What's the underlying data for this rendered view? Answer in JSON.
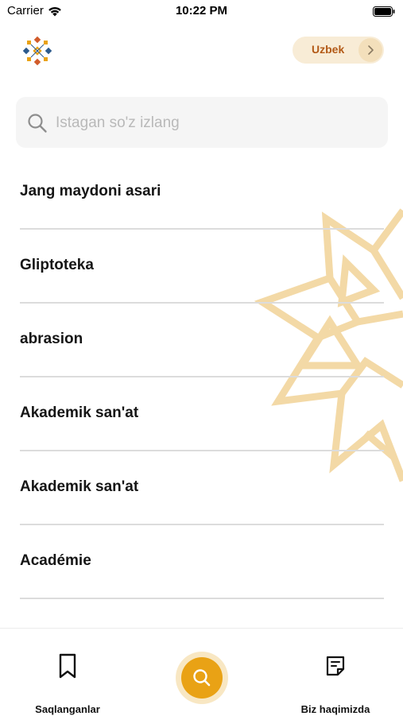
{
  "status_bar": {
    "carrier": "Carrier",
    "time": "10:22 PM"
  },
  "header": {
    "language_label": "Uzbek"
  },
  "search": {
    "placeholder": "Istagan so'z izlang",
    "value": ""
  },
  "words": [
    {
      "label": "Jang maydoni asari"
    },
    {
      "label": "Gliptoteka"
    },
    {
      "label": "abrasion"
    },
    {
      "label": "Akademik san'at"
    },
    {
      "label": "Akademik san'at"
    },
    {
      "label": "Académie"
    }
  ],
  "tab_bar": {
    "saved_label": "Saqlanganlar",
    "about_label": "Biz haqimizda"
  },
  "colors": {
    "accent": "#e9a215",
    "accent_light": "#f8e7c3",
    "language_text": "#b35a17",
    "decor": "#f3d9a6"
  }
}
